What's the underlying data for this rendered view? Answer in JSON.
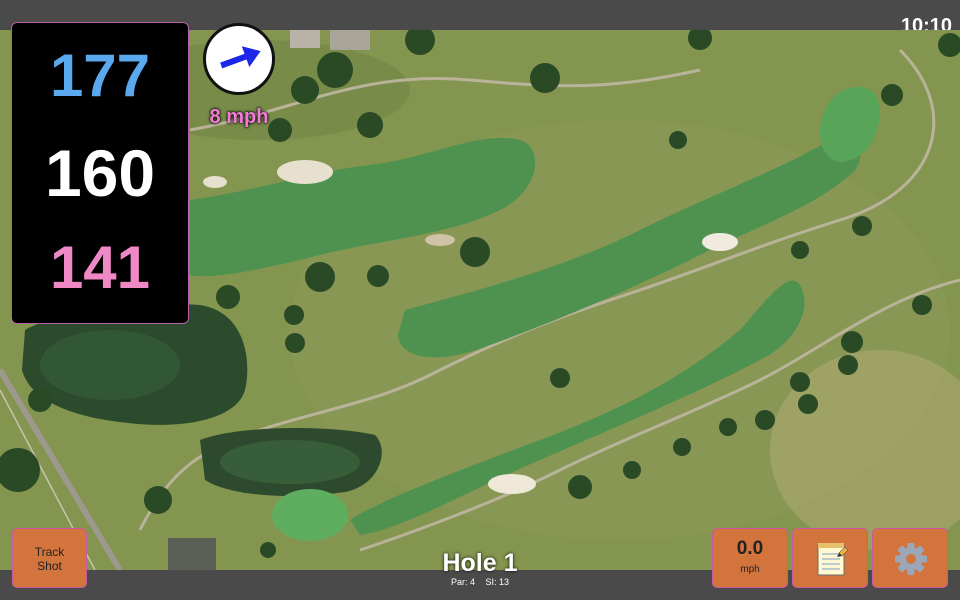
{
  "status": {
    "time": "10:10"
  },
  "distances": {
    "back": "177",
    "center": "160",
    "front": "141"
  },
  "wind": {
    "speed_label": "8 mph",
    "icon": "arrow-right-icon"
  },
  "hole": {
    "title": "Hole 1",
    "par_label": "Par: 4",
    "si_label": "SI: 13"
  },
  "buttons": {
    "track_shot_line1": "Track",
    "track_shot_line2": "Shot",
    "speed_value": "0.0",
    "speed_unit": "mph",
    "notes_icon": "notepad-icon",
    "settings_icon": "gear-icon"
  },
  "colors": {
    "back_distance": "#5aa9ef",
    "center_distance": "#ffffff",
    "front_distance": "#f088c6",
    "wind_text": "#f07ad4",
    "button": "#d2743c",
    "bar": "#4a4a4a"
  }
}
